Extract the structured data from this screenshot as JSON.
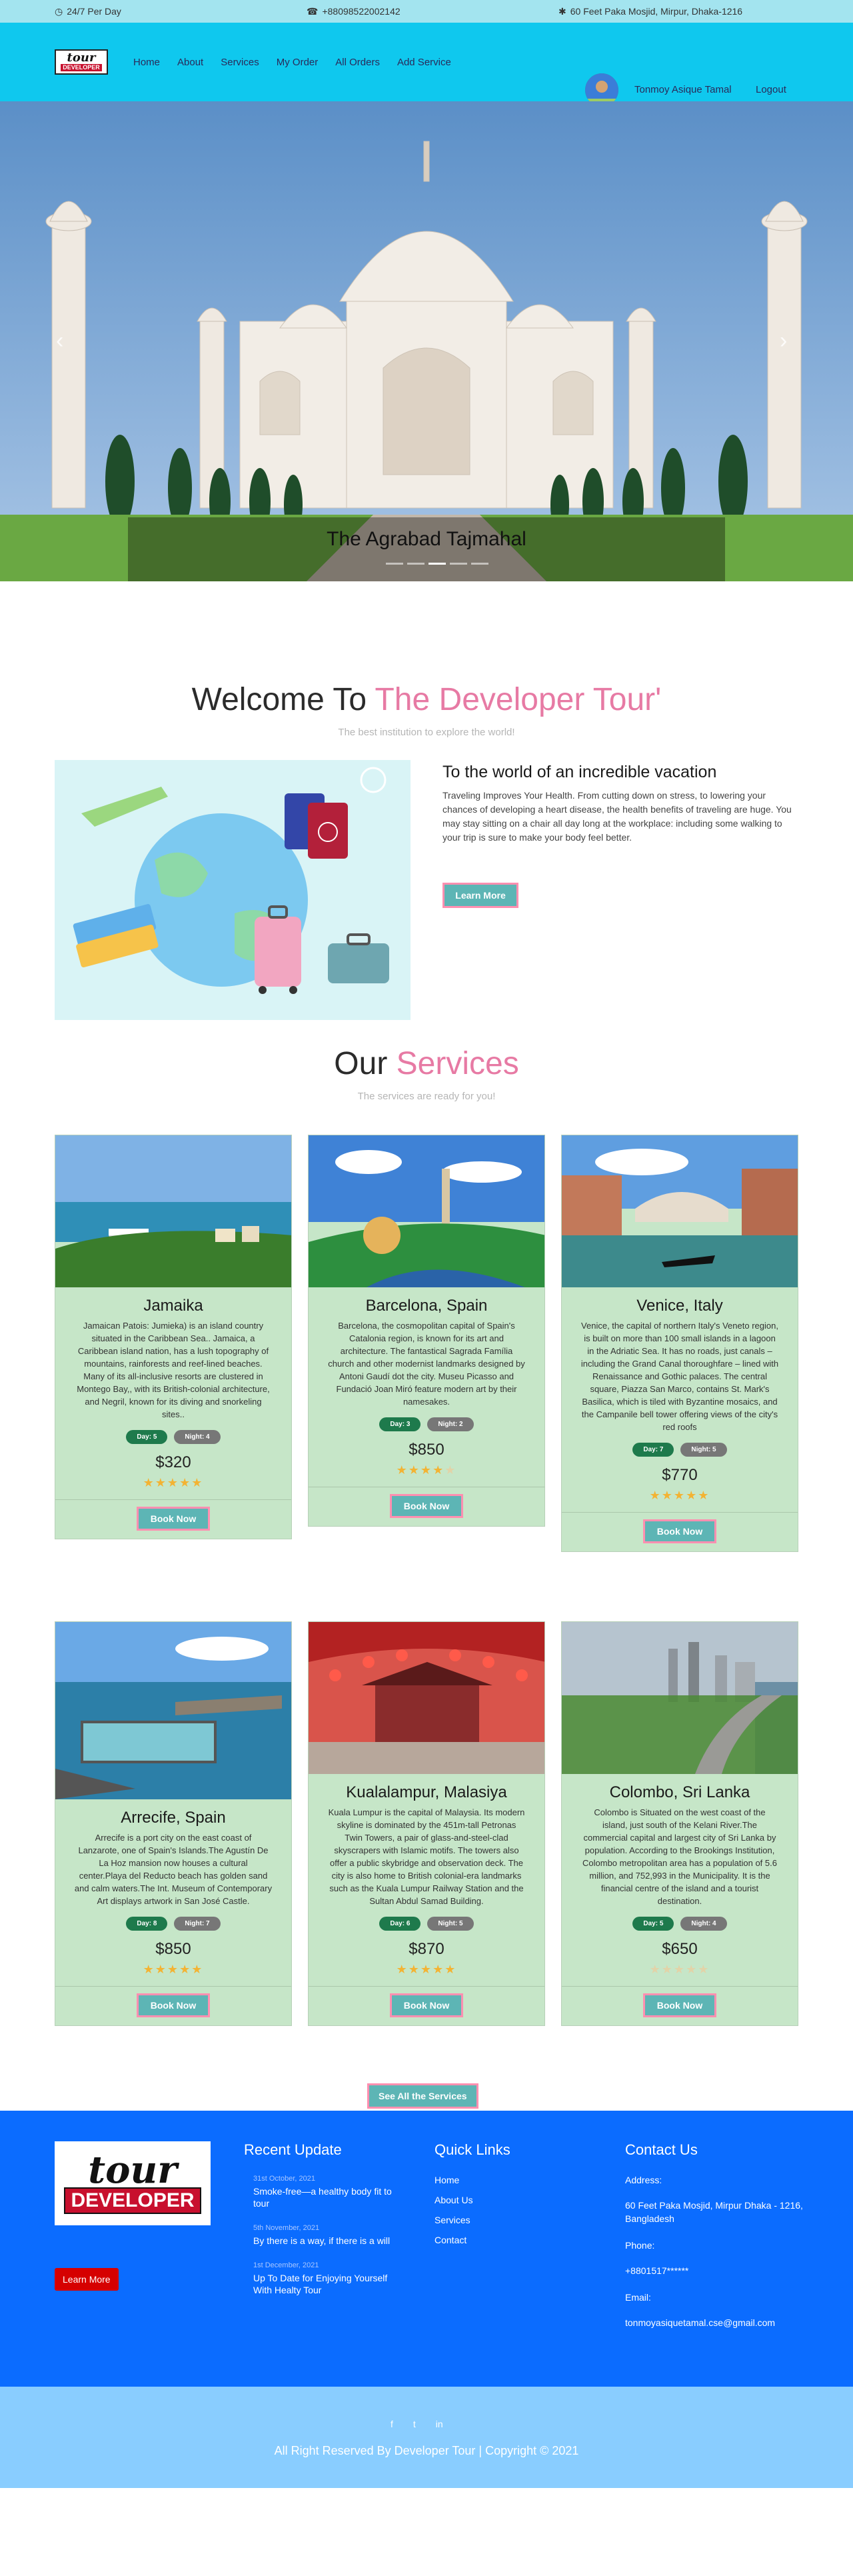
{
  "topbar": {
    "hours": "24/7 Per Day",
    "phone": "+88098522002142",
    "address": "60 Feet Paka Mosjid, Mirpur, Dhaka-1216"
  },
  "brand": {
    "logo_top": "tour",
    "logo_bottom": "DEVELOPER"
  },
  "nav": {
    "items": [
      "Home",
      "About",
      "Services",
      "My Order",
      "All Orders",
      "Add Service"
    ],
    "user_name": "Tonmoy Asique Tamal",
    "logout": "Logout"
  },
  "hero": {
    "caption": "The Agrabad Tajmahal",
    "slides": 5,
    "active_slide": 2
  },
  "welcome": {
    "title_plain": "Welcome To ",
    "title_accent": "The Developer Tour'",
    "subtitle": "The best institution to explore the world!",
    "heading": "To the world of an incredible vacation",
    "body": "Traveling Improves Your Health. From cutting down on stress, to lowering your chances of developing a heart disease, the health benefits of traveling are huge. You may stay sitting on a chair all day long at the workplace: including some walking to your trip is sure to make your body feel better.",
    "button": "Learn More"
  },
  "services": {
    "title_plain": "Our ",
    "title_accent": "Services",
    "subtitle": "The services are ready for you!",
    "book_label": "Book Now",
    "see_all": "See All the Services",
    "items": [
      {
        "name": "Jamaika",
        "desc": "Jamaican Patois: Jumieka) is an island country situated in the Caribbean Sea.. Jamaica, a Caribbean island nation, has a lush topography of mountains, rainforests and reef-lined beaches. Many of its all-inclusive resorts are clustered in Montego Bay,, with its British-colonial architecture, and Negril, known for its diving and snorkeling sites..",
        "day": "Day: 5",
        "night": "Night: 4",
        "price": "$320",
        "rating": 5
      },
      {
        "name": "Barcelona, Spain",
        "desc": "Barcelona, the cosmopolitan capital of Spain's Catalonia region, is known for its art and architecture. The fantastical Sagrada Família church and other modernist landmarks designed by Antoni Gaudí dot the city. Museu Picasso and Fundació Joan Miró feature modern art by their namesakes.",
        "day": "Day: 3",
        "night": "Night: 2",
        "price": "$850",
        "rating": 4
      },
      {
        "name": "Venice, Italy",
        "desc": "Venice, the capital of northern Italy's Veneto region, is built on more than 100 small islands in a lagoon in the Adriatic Sea. It has no roads, just canals – including the Grand Canal thoroughfare – lined with Renaissance and Gothic palaces. The central square, Piazza San Marco, contains St. Mark's Basilica, which is tiled with Byzantine mosaics, and the Campanile bell tower offering views of the city's red roofs",
        "day": "Day: 7",
        "night": "Night: 5",
        "price": "$770",
        "rating": 5
      },
      {
        "name": "Arrecife, Spain",
        "desc": "Arrecife is a port city on the east coast of Lanzarote, one of Spain's Islands.The Agustín De La Hoz mansion now houses a cultural center.Playa del Reducto beach has golden sand and calm waters.The Int. Museum of Contemporary Art displays artwork in San José Castle.",
        "day": "Day: 8",
        "night": "Night: 7",
        "price": "$850",
        "rating": 5
      },
      {
        "name": "Kualalampur, Malasiya",
        "desc": "Kuala Lumpur is the capital of Malaysia. Its modern skyline is dominated by the 451m-tall Petronas Twin Towers, a pair of glass-and-steel-clad skyscrapers with Islamic motifs. The towers also offer a public skybridge and observation deck. The city is also home to British colonial-era landmarks such as the Kuala Lumpur Railway Station and the Sultan Abdul Samad Building.",
        "day": "Day: 6",
        "night": "Night: 5",
        "price": "$870",
        "rating": 5
      },
      {
        "name": "Colombo, Sri Lanka",
        "desc": "Colombo is Situated on the west coast of the island, just south of the Kelani River.The commercial capital and largest city of Sri Lanka by population. According to the Brookings Institution, Colombo metropolitan area has a population of 5.6 million, and 752,993 in the Municipality. It is the financial centre of the island and a tourist destination.",
        "day": "Day: 5",
        "night": "Night: 4",
        "price": "$650",
        "rating": 0
      }
    ]
  },
  "footer": {
    "learn_more": "Learn More",
    "recent_title": "Recent Update",
    "recent": [
      {
        "date": "31st October, 2021",
        "title": "Smoke-free—a healthy body fit to tour"
      },
      {
        "date": "5th November, 2021",
        "title": "By there is a way, if there is a will"
      },
      {
        "date": "1st December, 2021",
        "title": "Up To Date for Enjoying Yourself With Healty Tour"
      }
    ],
    "links_title": "Quick Links",
    "links": [
      "Home",
      "About Us",
      "Services",
      "Contact"
    ],
    "contact_title": "Contact Us",
    "address_label": "Address:",
    "address": "60 Feet Paka Mosjid, Mirpur Dhaka - 1216, Bangladesh",
    "phone_label": "Phone:",
    "phone": "+8801517******",
    "email_label": "Email:",
    "email": "tonmoyasiquetamal.cse@gmail.com",
    "social": [
      "f",
      "t",
      "in"
    ],
    "copyright": "All Right Reserved By Developer Tour | Copyright © 2021"
  },
  "colors": {
    "topbar": "#a3e4ef",
    "nav": "#0fc8ee",
    "accent_pink": "#e77aa4",
    "card": "#c6e6c8",
    "footer": "#0b6cff",
    "bottom": "#89cdff"
  }
}
